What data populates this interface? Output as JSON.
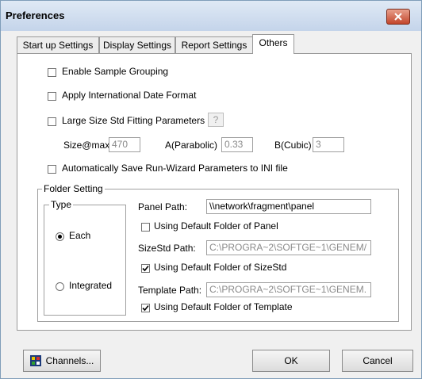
{
  "window": {
    "title": "Preferences"
  },
  "tabs": [
    {
      "label": "Start up Settings",
      "active": false
    },
    {
      "label": "Display Settings",
      "active": false
    },
    {
      "label": "Report Settings",
      "active": false
    },
    {
      "label": "Others",
      "active": true
    }
  ],
  "options": {
    "enable_sample_grouping": {
      "label": "Enable Sample Grouping",
      "checked": false
    },
    "apply_international_date": {
      "label": "Apply International Date Format",
      "checked": false
    },
    "large_size_std": {
      "label": "Large Size Std Fitting Parameters",
      "checked": false,
      "help_label": "?"
    },
    "auto_save_run_wizard": {
      "label": "Automatically Save Run-Wizard Parameters to INI file",
      "checked": false
    }
  },
  "params": {
    "size_at_max": {
      "label": "Size@max",
      "value": "470"
    },
    "a_parabolic": {
      "label": "A(Parabolic)",
      "value": "0.33"
    },
    "b_cubic": {
      "label": "B(Cubic)",
      "value": "3"
    }
  },
  "folder_setting": {
    "group_label": "Folder Setting",
    "type_group_label": "Type",
    "type_each": {
      "label": "Each",
      "selected": true
    },
    "type_integrated": {
      "label": "Integrated",
      "selected": false
    },
    "panel_path": {
      "label": "Panel Path:",
      "value": "\\\\network\\fragment\\panel"
    },
    "use_default_panel": {
      "label": "Using Default Folder of Panel",
      "checked": false
    },
    "sizestd_path": {
      "label": "SizeStd Path:",
      "value": "C:\\PROGRA~2\\SOFTGE~1\\GENEM/"
    },
    "use_default_sizestd": {
      "label": "Using Default Folder of SizeStd",
      "checked": true
    },
    "template_path": {
      "label": "Template Path:",
      "value": "C:\\PROGRA~2\\SOFTGE~1\\GENEM."
    },
    "use_default_template": {
      "label": "Using Default Folder of Template",
      "checked": true
    }
  },
  "footer": {
    "channels_label": "Channels...",
    "ok_label": "OK",
    "cancel_label": "Cancel"
  },
  "colors": {
    "titlebar": "#c4d4ea",
    "close_button": "#c3462c",
    "dialog_bg": "#f0f0f0"
  },
  "icons": {
    "close": "close-icon",
    "check": "check-icon",
    "channels": "grid-icon"
  }
}
